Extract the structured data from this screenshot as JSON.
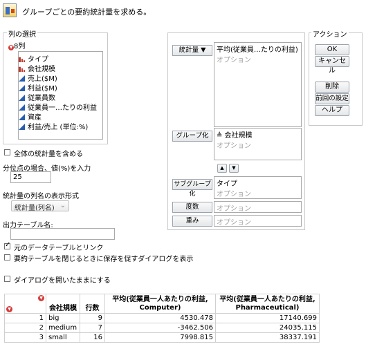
{
  "header": {
    "title": "グループごとの要約統計量を求める。"
  },
  "column_select": {
    "legend": "列の選択",
    "count_label": "8列",
    "items": [
      {
        "label": "タイプ",
        "icon": "nominal-icon"
      },
      {
        "label": "会社規模",
        "icon": "nominal-icon"
      },
      {
        "label": "売上($M)",
        "icon": "continuous-icon"
      },
      {
        "label": "利益($M)",
        "icon": "continuous-icon"
      },
      {
        "label": "従業員数",
        "icon": "continuous-icon"
      },
      {
        "label": "従業員一…たりの利益",
        "icon": "continuous-icon"
      },
      {
        "label": "資産",
        "icon": "continuous-icon"
      },
      {
        "label": "利益/売上 (単位:%)",
        "icon": "continuous-icon"
      }
    ]
  },
  "roles": {
    "stats_button": "統計量 ▼",
    "stats_value": "平均(従業員…たりの利益)",
    "stats_option": "オプション",
    "group_button": "グループ化",
    "group_value": "≜ 会社規模",
    "group_option": "オプション",
    "subgroup_button": "サブグループ化",
    "subgroup_value": "タイプ",
    "subgroup_option": "オプション",
    "freq_button": "度数",
    "freq_option": "オプション",
    "weight_button": "重み",
    "weight_option": "オプション",
    "up_arrow": "▲",
    "down_arrow": "▼"
  },
  "actions": {
    "legend": "アクション",
    "ok": "OK",
    "cancel": "キャンセル",
    "remove": "削除",
    "recall": "前回の設定",
    "help": "ヘルプ"
  },
  "options": {
    "include_overall": "全体の統計量を含める",
    "include_overall_checked": false,
    "quantile_label": "分位点の場合、値(%)を入力",
    "quantile_value": "25",
    "stat_col_name_label": "統計量の列名の表示形式",
    "stat_col_name_value": "統計量(列名)",
    "output_table_label": "出力テーブル名:",
    "output_table_value": "",
    "link_to_original": "元のデータテーブルとリンク",
    "link_to_original_checked": true,
    "prompt_save": "要約テーブルを閉じるときに保存を促すダイアログを表示",
    "prompt_save_checked": false,
    "keep_dialog_open": "ダイアログを開いたままにする",
    "keep_dialog_open_checked": false
  },
  "table": {
    "headers": [
      "会社規模",
      "行数",
      "平均(従業員一人あたりの利益, Computer)",
      "平均(従業員一人あたりの利益, Pharmaceutical)"
    ],
    "header_col3_line1": "平均(従業員一人あたりの利益,",
    "header_col3_line2": "Computer)",
    "header_col4_line1": "平均(従業員一人あたりの利益,",
    "header_col4_line2": "Pharmaceutical)",
    "rows": [
      {
        "n": "1",
        "size": "big",
        "count": "9",
        "computer": "4530.478",
        "pharma": "17140.699"
      },
      {
        "n": "2",
        "size": "medium",
        "count": "7",
        "computer": "-3462.506",
        "pharma": "24035.115"
      },
      {
        "n": "3",
        "size": "small",
        "count": "16",
        "computer": "7998.815",
        "pharma": "38337.191"
      }
    ]
  }
}
